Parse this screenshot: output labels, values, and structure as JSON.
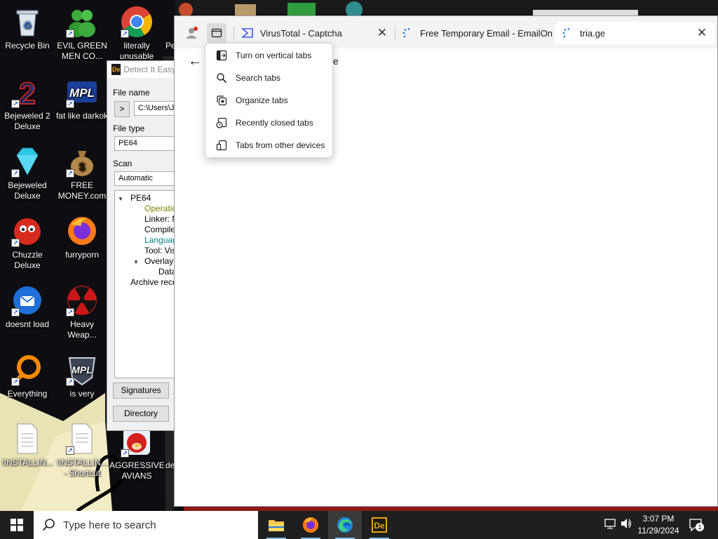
{
  "desktop_icons": [
    {
      "label": "Recycle Bin",
      "icon": "recycle-bin-icon"
    },
    {
      "label": "EVIL GREEN MEN CO...",
      "icon": "green-men-icon"
    },
    {
      "label": "literally unusable",
      "icon": "chrome-icon"
    },
    {
      "label": "Pe",
      "icon": "partial-icon"
    },
    {
      "label": "Bejeweled 2 Deluxe",
      "icon": "bejeweled-2-icon"
    },
    {
      "label": "fat like darkok",
      "icon": "mpl-icon"
    },
    {
      "label": "Bejeweled Deluxe",
      "icon": "diamond-icon"
    },
    {
      "label": "FREE MONEY.com",
      "icon": "money-bag-icon"
    },
    {
      "label": "Chuzzle Deluxe",
      "icon": "chuzzle-icon"
    },
    {
      "label": "furryporn",
      "icon": "firefox-icon"
    },
    {
      "label": "doesnt load",
      "icon": "thunderbird-icon"
    },
    {
      "label": "Heavy Weap...",
      "icon": "radiation-icon"
    },
    {
      "label": "Everything",
      "icon": "everything-search-icon"
    },
    {
      "label": "is very",
      "icon": "mpl-shield-icon"
    },
    {
      "label": "!INSTALLIN...",
      "icon": "text-file-icon"
    },
    {
      "label": "!INSTALLIN... - Shortcut",
      "icon": "text-file-shortcut-icon"
    },
    {
      "label": "AGGRESSIVE AVIANS",
      "icon": "angry-bird-icon"
    },
    {
      "label": "de",
      "icon": "partial-icon"
    }
  ],
  "die_window": {
    "title": "Detect It Easy",
    "file_name_label": "File name",
    "browse_button": ">",
    "file_path": "C:\\Users\\Ja",
    "file_type_label": "File type",
    "file_type_value": "PE64",
    "scan_label": "Scan",
    "scan_value": "Automatic",
    "tree": [
      {
        "text": "PE64",
        "color": "#000000"
      },
      {
        "text": "Operatio",
        "color": "#808000"
      },
      {
        "text": "Linker: M",
        "color": "#000000"
      },
      {
        "text": "Compile",
        "color": "#000000"
      },
      {
        "text": "Languag",
        "color": "#008080"
      },
      {
        "text": "Tool: Vis",
        "color": "#000000"
      },
      {
        "text": "Overlay:",
        "color": "#000000"
      },
      {
        "text": "Data",
        "color": "#000000"
      },
      {
        "text": "Archive reco",
        "color": "#000000"
      }
    ],
    "signatures_button": "Signatures",
    "directory_button": "Directory"
  },
  "browser": {
    "tabs": [
      {
        "title": "VirusTotal - Captcha",
        "icon": "virustotal-icon",
        "active": false
      },
      {
        "title": "Free Temporary Email - EmailOn",
        "icon": "loading-icon",
        "active": false
      },
      {
        "title": "tria.ge",
        "icon": "loading-icon",
        "active": true
      }
    ],
    "close_glyph": "✕",
    "address_partial": "e"
  },
  "tab_menu": {
    "items": [
      {
        "label": "Turn on vertical tabs",
        "icon": "vertical-tabs-icon"
      },
      {
        "label": "Search tabs",
        "icon": "search-icon"
      },
      {
        "label": "Organize tabs",
        "icon": "organize-tabs-icon"
      },
      {
        "label": "Recently closed tabs",
        "icon": "recently-closed-icon"
      },
      {
        "label": "Tabs from other devices",
        "icon": "other-devices-icon"
      }
    ]
  },
  "taskbar": {
    "search_placeholder": "Type here to search",
    "apps": [
      {
        "name": "File Explorer",
        "icon": "folder-icon"
      },
      {
        "name": "Firefox",
        "icon": "firefox-icon"
      },
      {
        "name": "Edge",
        "icon": "edge-icon"
      },
      {
        "name": "Detect It Easy",
        "icon": "die-icon"
      }
    ],
    "time": "3:07 PM",
    "date": "11/29/2024",
    "notification_count": "1"
  }
}
